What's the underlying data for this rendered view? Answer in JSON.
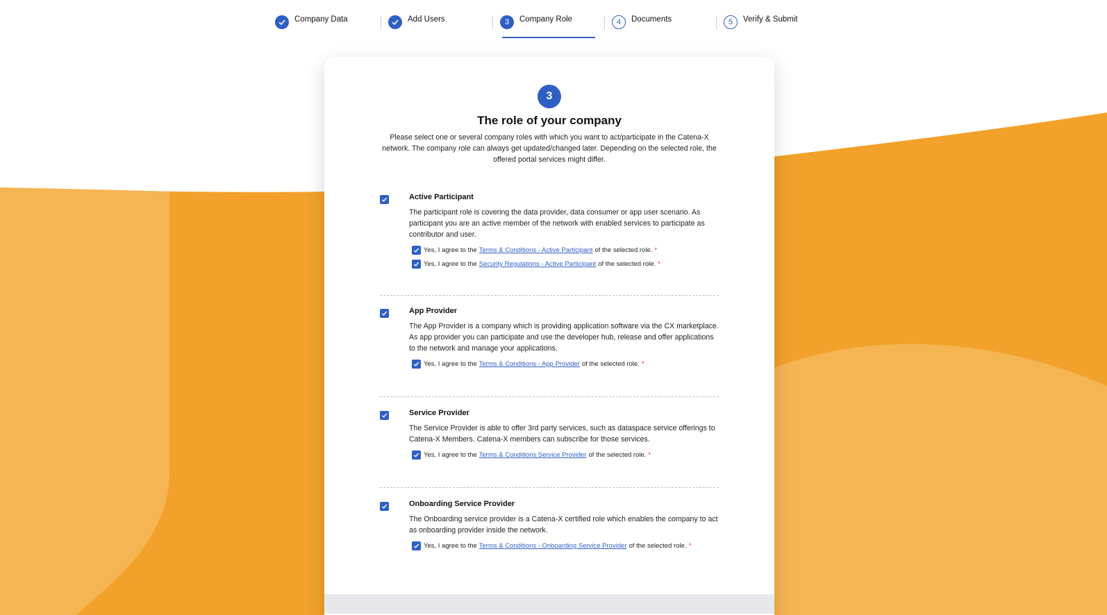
{
  "stepper": {
    "steps": [
      {
        "label": "Company Data",
        "status": "done",
        "number": "1"
      },
      {
        "label": "Add Users",
        "status": "done",
        "number": "2"
      },
      {
        "label": "Company Role",
        "status": "active",
        "number": "3"
      },
      {
        "label": "Documents",
        "status": "todo",
        "number": "4"
      },
      {
        "label": "Verify & Submit",
        "status": "todo",
        "number": "5"
      }
    ]
  },
  "card": {
    "step_number": "3",
    "title": "The role of your company",
    "intro": "Please select one or several company roles with which you want to act/participate in the Catena-X network. The company role can always get updated/changed later. Depending on the selected role, the offered portal services might differ."
  },
  "roles": [
    {
      "title": "Active Participant",
      "checked": true,
      "description": "The participant role is covering the data provider, data consumer or app user scenario. As participant you are an active member of the network with enabled services to participate as contributor and user.",
      "agreements": [
        {
          "prefix": "Yes, I agree to the",
          "link": "Terms & Conditions - Active Participant",
          "suffix": "of the selected role.",
          "required": "*",
          "checked": true
        },
        {
          "prefix": "Yes, I agree to the",
          "link": "Security Regulations - Active Participant",
          "suffix": "of the selected role.",
          "required": "*",
          "checked": true
        }
      ]
    },
    {
      "title": "App Provider",
      "checked": true,
      "description": "The App Provider is a company which is providing application software via the CX marketplace. As app provider you can participate and use the developer hub, release and offer applications to the network and manage your applications.",
      "agreements": [
        {
          "prefix": "Yes, I agree to the",
          "link": "Terms & Conditions - App Provider",
          "suffix": "of the selected role.",
          "required": "*",
          "checked": true
        }
      ]
    },
    {
      "title": "Service Provider",
      "checked": true,
      "description": "The Service Provider is able to offer 3rd party services, such as dataspace service offerings to Catena-X Members. Catena-X members can subscribe for those services.",
      "agreements": [
        {
          "prefix": "Yes, I agree to the",
          "link": "Terms & Conditions Service Provider",
          "suffix": "of the selected role.",
          "required": "*",
          "checked": true
        }
      ]
    },
    {
      "title": "Onboarding Service Provider",
      "checked": true,
      "description": "The Onboarding service provider is a Catena-X certified role which enables the company to act as onboarding provider inside the network.",
      "agreements": [
        {
          "prefix": "Yes, I agree to the",
          "link": "Terms & Conditions - Onboarding Service Provider",
          "suffix": "of the selected role.",
          "required": "*",
          "checked": true
        }
      ]
    }
  ],
  "colors": {
    "accent": "#2f5ec4",
    "background_orange": "#f2a22a",
    "background_orange_light": "#f5b553",
    "required": "#dd3333"
  },
  "icons": {
    "step_done": "check-icon",
    "checkbox": "checkbox-checked-icon"
  }
}
